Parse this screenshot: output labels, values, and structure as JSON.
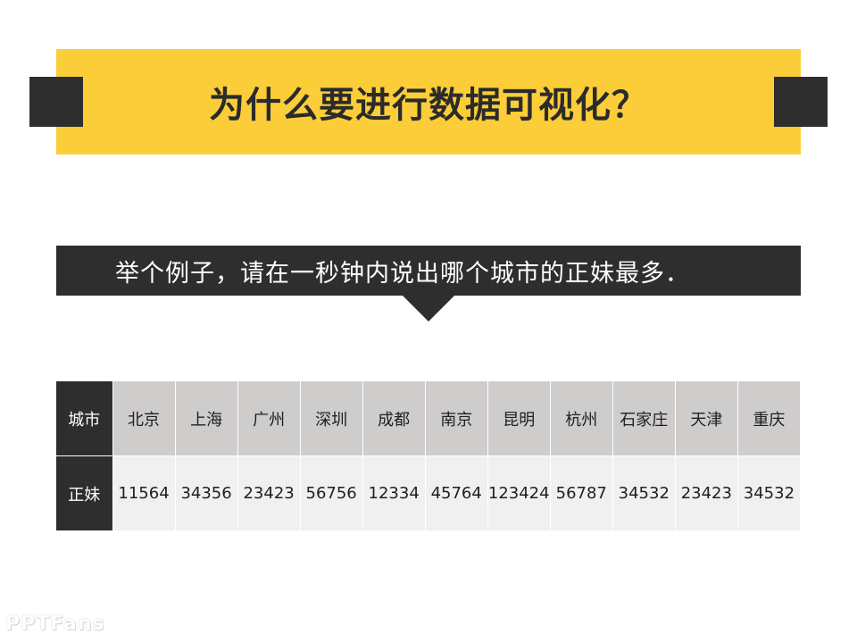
{
  "title": "为什么要进行数据可视化？",
  "callout": "举个例子，请在一秒钟内说出哪个城市的正妹最多．",
  "table": {
    "row_headers": [
      "城市",
      "正妹"
    ],
    "cities": [
      "北京",
      "上海",
      "广州",
      "深圳",
      "成都",
      "南京",
      "昆明",
      "杭州",
      "石家庄",
      "天津",
      "重庆"
    ],
    "counts": [
      "11564",
      "34356",
      "23423",
      "56756",
      "12334",
      "45764",
      "123424",
      "56787",
      "34532",
      "23423",
      "34532"
    ]
  },
  "watermark": "PPTFans",
  "colors": {
    "accent_yellow": "#fbcd39",
    "dark": "#2e2e2e",
    "header_cell": "#cfcccc",
    "value_cell": "#f0f0f0"
  }
}
